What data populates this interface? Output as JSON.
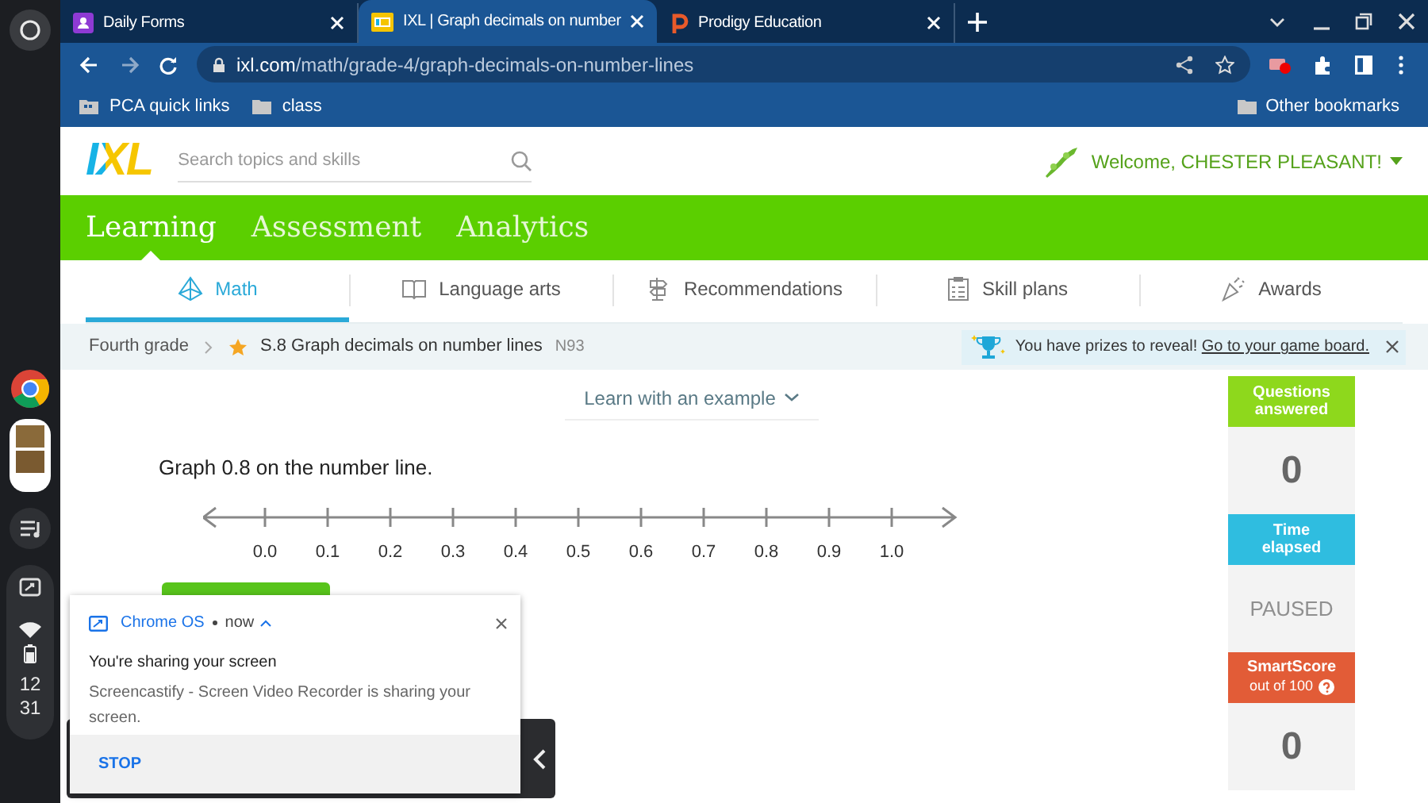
{
  "shelf": {
    "time": [
      "12",
      "31"
    ]
  },
  "tabs": [
    {
      "title": "Daily Forms",
      "kind": "forms",
      "selected": false
    },
    {
      "title": "IXL | Graph decimals on number",
      "kind": "ixl",
      "selected": true
    },
    {
      "title": "Prodigy Education",
      "kind": "prodigy",
      "selected": false
    }
  ],
  "address_bar": {
    "domain": "ixl.com",
    "path": "/math/grade-4/graph-decimals-on-number-lines"
  },
  "bookmarks": [
    {
      "label": "PCA quick links",
      "kind": "apps"
    },
    {
      "label": "class",
      "kind": "folder"
    }
  ],
  "other_bookmarks": "Other bookmarks",
  "ixl": {
    "logo": "IXL",
    "search_placeholder": "Search topics and skills",
    "welcome": "Welcome, CHESTER PLEASANT!",
    "main_nav": [
      {
        "label": "Learning",
        "selected": true
      },
      {
        "label": "Assessment",
        "selected": false
      },
      {
        "label": "Analytics",
        "selected": false
      }
    ],
    "subnav": [
      {
        "label": "Math",
        "kind": "math",
        "selected": true
      },
      {
        "label": "Language arts",
        "kind": "book",
        "selected": false
      },
      {
        "label": "Recommendations",
        "kind": "signpost",
        "selected": false
      },
      {
        "label": "Skill plans",
        "kind": "plan",
        "selected": false
      },
      {
        "label": "Awards",
        "kind": "awards",
        "selected": false
      }
    ],
    "breadcrumb": {
      "grade": "Fourth grade",
      "skill": "S.8 Graph decimals on number lines",
      "code": "N93"
    },
    "prize": {
      "text": "You have prizes to reveal!",
      "link": "Go to your game board."
    },
    "learn_example": "Learn with an example",
    "question": "Graph 0.8 on the number line.",
    "number_line_labels": [
      "0.0",
      "0.1",
      "0.2",
      "0.3",
      "0.4",
      "0.5",
      "0.6",
      "0.7",
      "0.8",
      "0.9",
      "1.0"
    ],
    "stats": [
      {
        "kind": "questions",
        "title": "Questions answered",
        "value": "0"
      },
      {
        "kind": "time",
        "title": "Time elapsed",
        "value": "PAUSED"
      },
      {
        "kind": "score",
        "title": "SmartScore",
        "subtitle": "out of 100",
        "value": "0"
      }
    ]
  },
  "notification": {
    "source": "Chrome OS",
    "time": "now",
    "title": "You're sharing your screen",
    "body": "Screencastify - Screen Video Recorder is sharing your screen.",
    "action": "STOP"
  }
}
